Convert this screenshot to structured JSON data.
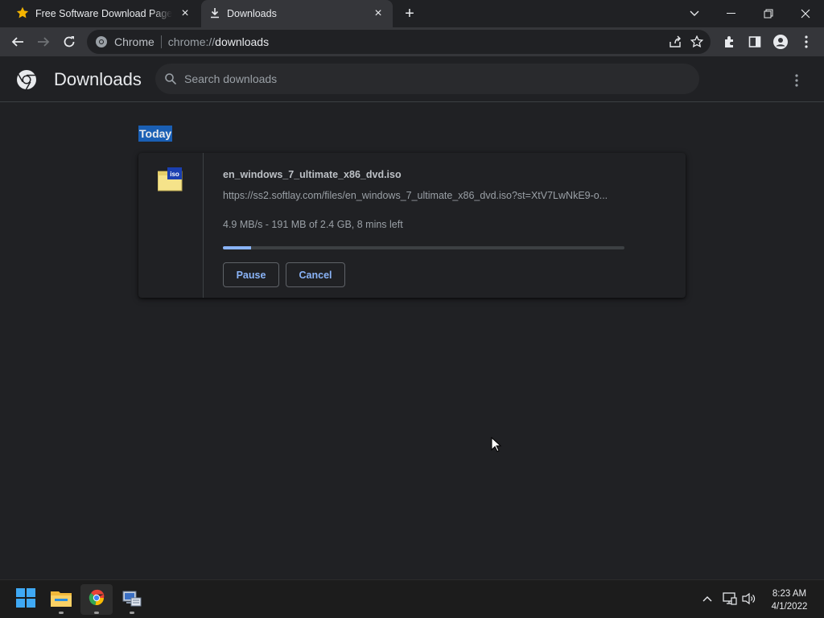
{
  "browser": {
    "tabs": [
      {
        "title": "Free Software Download Page - SoftLay",
        "icon": "star-icon",
        "active": false
      },
      {
        "title": "Downloads",
        "icon": "download-icon",
        "active": true
      }
    ],
    "omnibox": {
      "security_label": "Chrome",
      "url_scheme": "chrome://",
      "url_host": "downloads"
    }
  },
  "downloads_page": {
    "title": "Downloads",
    "search_placeholder": "Search downloads",
    "date_group": "Today",
    "items": [
      {
        "filename": "en_windows_7_ultimate_x86_dvd.iso",
        "url": "https://ss2.softlay.com/files/en_windows_7_ultimate_x86_dvd.iso?st=XtV7LwNkE9-o...",
        "status": "4.9 MB/s - 191 MB of 2.4 GB, 8 mins left",
        "progress_fraction": 0.07,
        "file_icon": "iso-file-icon",
        "pause_label": "Pause",
        "cancel_label": "Cancel"
      }
    ]
  },
  "taskbar": {
    "apps": [
      "start-icon",
      "file-explorer-icon",
      "chrome-icon",
      "network-app-icon"
    ],
    "time": "8:23 AM",
    "date": "4/1/2022"
  },
  "colors": {
    "accent": "#8ab4f8",
    "background": "#202124",
    "toolbar": "#35363a",
    "selection": "#1a5fb4"
  }
}
